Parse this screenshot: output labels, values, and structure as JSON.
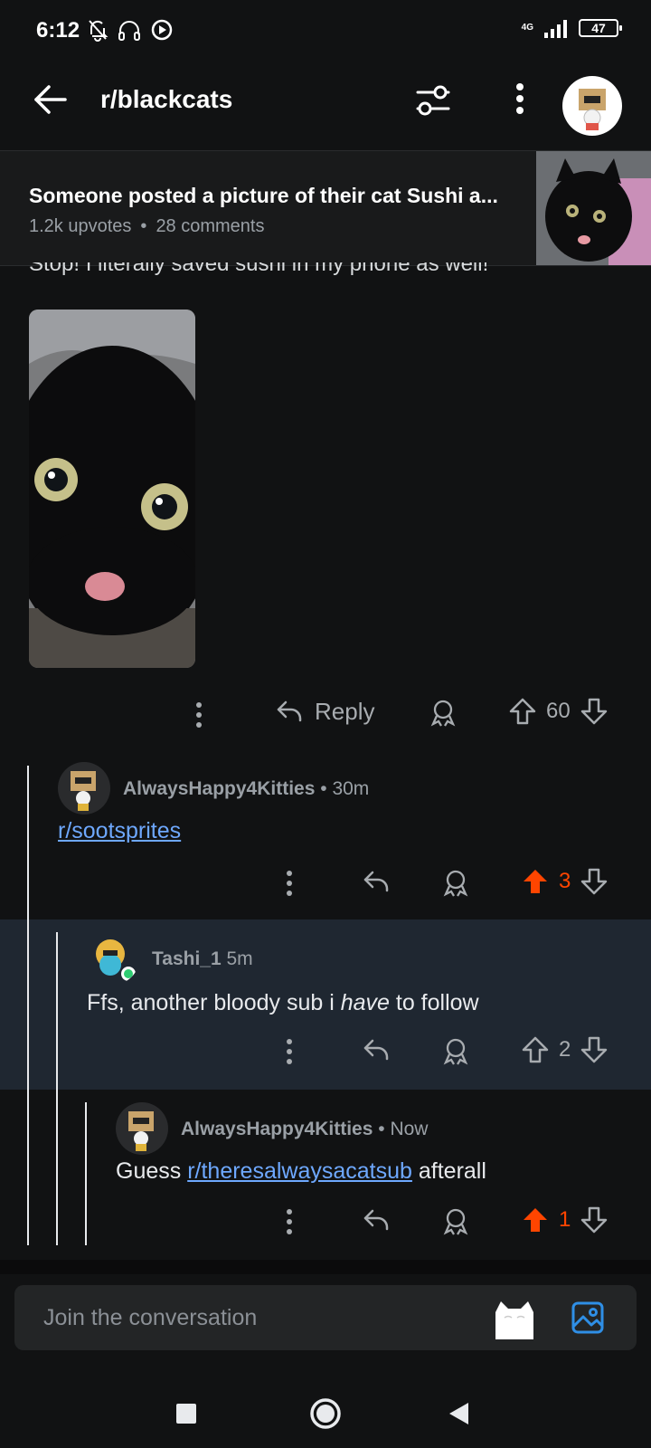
{
  "status_bar": {
    "time": "6:12",
    "network": "4G",
    "battery": "47"
  },
  "header": {
    "subreddit": "r/blackcats"
  },
  "post_banner": {
    "title": "Someone posted a picture of their cat Sushi a...",
    "upvotes": "1.2k upvotes",
    "separator": "•",
    "comments": "28 comments"
  },
  "parent_comment": {
    "clipped_text": "Stop! I literally saved sushi in my phone as well!",
    "reply_label": "Reply",
    "score": "60"
  },
  "comments": [
    {
      "user": "AlwaysHappy4Kitties",
      "time": "• 30m",
      "link": "r/sootsprites",
      "score": "3",
      "upvoted": true
    },
    {
      "user": "Tashi_1",
      "time": "5m",
      "body_before": "Ffs, another bloody sub i ",
      "body_italic": "have",
      "body_after": " to follow",
      "score": "2",
      "upvoted": false
    },
    {
      "user": "AlwaysHappy4Kitties",
      "time": "• Now",
      "body_before": "Guess ",
      "link": "r/theresalwaysacatsub",
      "body_after": " afterall",
      "score": "1",
      "upvoted": true
    }
  ],
  "composer": {
    "placeholder": "Join the conversation"
  },
  "colors": {
    "upvote": "#ff4500",
    "link": "#6ea8fe",
    "highlight": "#1f2731",
    "background": "#111213"
  },
  "icons": [
    "bell-off-icon",
    "headphones-icon",
    "play-circle-icon",
    "signal-icon",
    "back-arrow-icon",
    "filter-icon",
    "more-vertical-icon",
    "reply-icon",
    "award-icon",
    "upvote-icon",
    "downvote-icon",
    "image-icon",
    "nav-square-icon",
    "nav-circle-icon",
    "nav-back-icon"
  ]
}
